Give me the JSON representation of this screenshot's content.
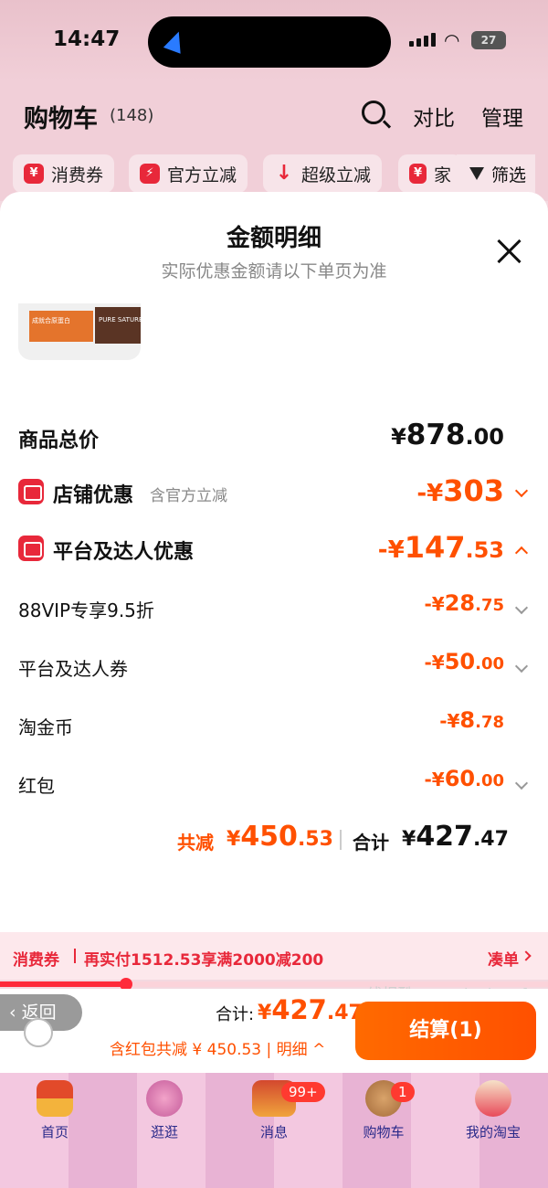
{
  "status": {
    "time": "14:47",
    "battery": "27"
  },
  "header": {
    "title": "购物车",
    "count": "(148)",
    "compare": "对比",
    "manage": "管理"
  },
  "filters": [
    {
      "label": "消费券",
      "icon": "¥"
    },
    {
      "label": "官方立减",
      "icon": "⚡"
    },
    {
      "label": "超级立减",
      "icon": "↓"
    },
    {
      "label": "家",
      "icon": "¥"
    }
  ],
  "filter_button": "筛选",
  "sheet": {
    "title": "金额明细",
    "subtitle": "实际优惠金额请以下单页为准",
    "product_thumb_text": [
      "成就合原蛋白",
      "PURE SATURE"
    ],
    "rows": {
      "total_price": {
        "label": "商品总价",
        "currency": "¥",
        "int": "878",
        "dec": ".00"
      },
      "store_discount": {
        "label": "店铺优惠",
        "note": "含官方立减",
        "prefix": "-¥",
        "int": "303",
        "dec": ""
      },
      "platform_discount": {
        "label": "平台及达人优惠",
        "prefix": "-¥",
        "int": "147",
        "dec": ".53"
      },
      "vip": {
        "label": "88VIP专享9.5折",
        "prefix": "-¥",
        "int": "28",
        "dec": ".75"
      },
      "coupon": {
        "label": "平台及达人券",
        "prefix": "-¥",
        "int": "50",
        "dec": ".00"
      },
      "coins": {
        "label": "淘金币",
        "prefix": "-¥",
        "int": "8",
        "dec": ".78"
      },
      "redpacket": {
        "label": "红包",
        "prefix": "-¥",
        "int": "60",
        "dec": ".00"
      }
    },
    "summary": {
      "reduce_label": "共减",
      "reduce_currency": "¥",
      "reduce_int": "450",
      "reduce_dec": ".53",
      "total_label": "合计",
      "total_currency": "¥",
      "total_int": "427",
      "total_dec": ".47"
    }
  },
  "coupon_bar": {
    "tag": "消费券",
    "message": "再实付1512.53享满2000减200",
    "action": "凑单",
    "progress": 0.23
  },
  "watermark": "线报酷-new.xianbao.fun",
  "checkout": {
    "back": "返回",
    "total_label": "合计:",
    "total_currency": "¥",
    "total_int": "427",
    "total_dec": ".47",
    "detail": "含红包共减 ¥ 450.53 | 明细",
    "pay_label": "结算(1)"
  },
  "tabbar": [
    {
      "label": "首页",
      "icon": "home-icon",
      "badge": ""
    },
    {
      "label": "逛逛",
      "icon": "explore-icon",
      "badge": ""
    },
    {
      "label": "消息",
      "icon": "message-icon",
      "badge": "99+"
    },
    {
      "label": "购物车",
      "icon": "cart-icon",
      "badge": "1"
    },
    {
      "label": "我的淘宝",
      "icon": "profile-icon",
      "badge": ""
    }
  ],
  "colors": {
    "accent": "#ff5000",
    "red": "#e8283a"
  }
}
